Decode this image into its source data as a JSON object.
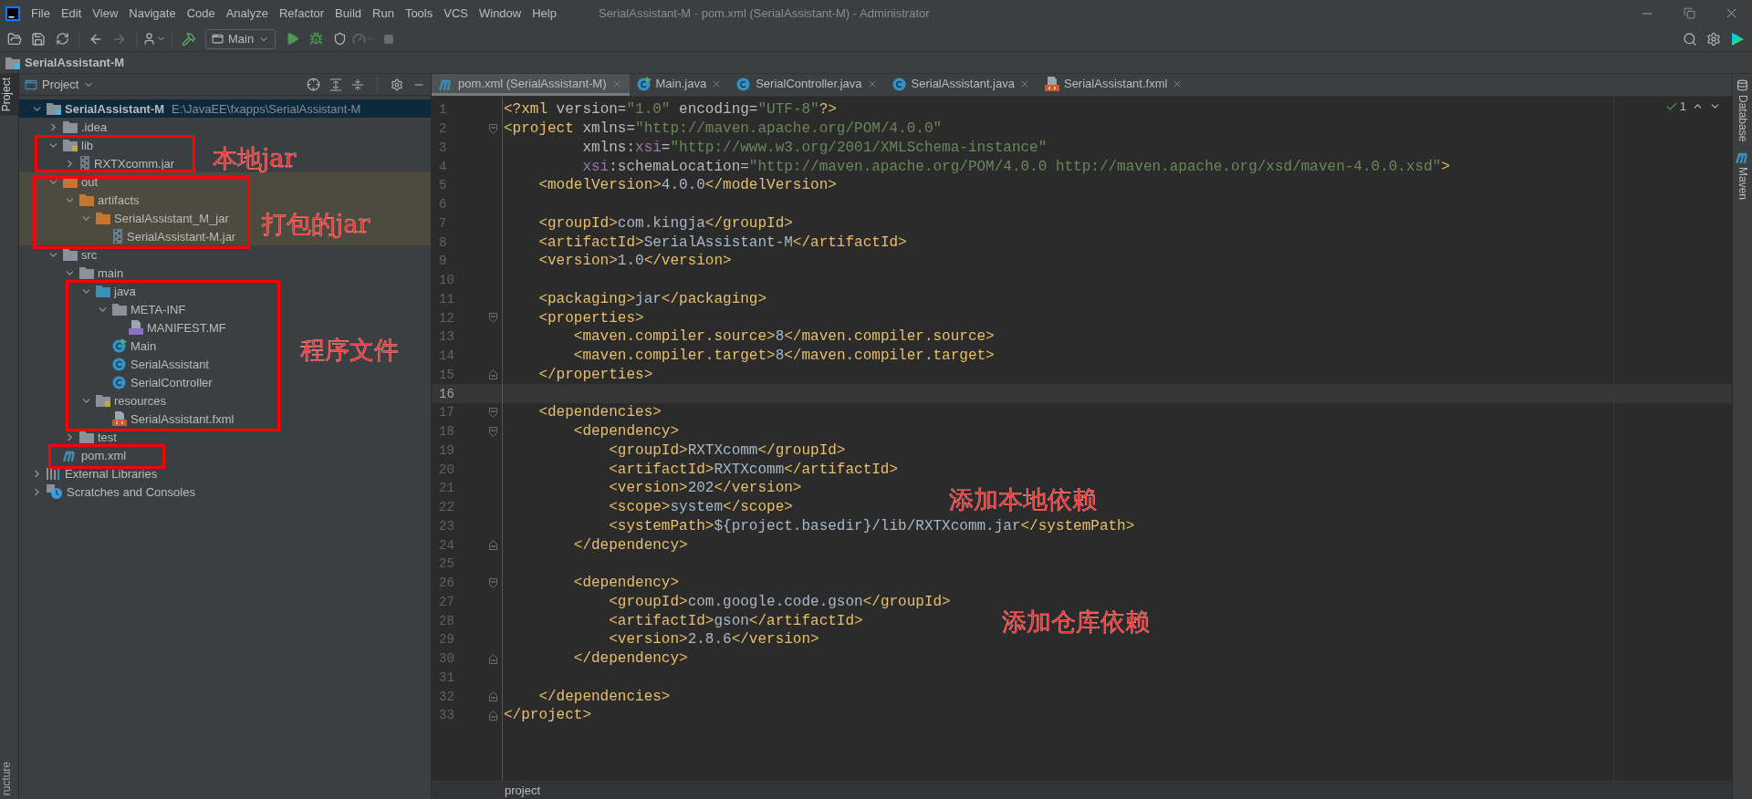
{
  "title_bar": {
    "menus": [
      "File",
      "Edit",
      "View",
      "Navigate",
      "Code",
      "Analyze",
      "Refactor",
      "Build",
      "Run",
      "Tools",
      "VCS",
      "Window",
      "Help"
    ],
    "title": "SerialAssistant-M - pom.xml (SerialAssistant-M) - Administrator"
  },
  "toolbar": {
    "run_config": "Main"
  },
  "nav_bar": {
    "breadcrumb": "SerialAssistant-M"
  },
  "left_strip": [
    {
      "label": "Project",
      "selected": true
    },
    {
      "label": "ructure",
      "selected": false
    }
  ],
  "project_panel": {
    "title": "Project",
    "tree": [
      {
        "label": "SerialAssistant-M",
        "path": "E:\\JavaEE\\fxapps\\SerialAssistant-M",
        "kind": "module",
        "expanded": true,
        "selected": true,
        "excluded": false,
        "children": [
          {
            "label": ".idea",
            "kind": "folder",
            "expanded": false,
            "selected": false,
            "excluded": false
          },
          {
            "label": "lib",
            "kind": "folder-lib",
            "expanded": true,
            "selected": false,
            "excluded": false,
            "children": [
              {
                "label": "RXTXcomm.jar",
                "kind": "jar",
                "expanded": false,
                "selected": false,
                "excluded": false
              }
            ]
          },
          {
            "label": "out",
            "kind": "folder-excluded",
            "expanded": true,
            "selected": false,
            "excluded": true,
            "children": [
              {
                "label": "artifacts",
                "kind": "folder-excluded",
                "expanded": true,
                "selected": false,
                "excluded": true,
                "children": [
                  {
                    "label": "SerialAssistant_M_jar",
                    "kind": "folder-excluded",
                    "expanded": true,
                    "selected": false,
                    "excluded": true,
                    "children": [
                      {
                        "label": "SerialAssistant-M.jar",
                        "kind": "jar",
                        "selected": false,
                        "excluded": true
                      }
                    ]
                  }
                ]
              }
            ]
          },
          {
            "label": "src",
            "kind": "folder",
            "expanded": true,
            "selected": false,
            "excluded": false,
            "children": [
              {
                "label": "main",
                "kind": "folder",
                "expanded": true,
                "selected": false,
                "excluded": false,
                "children": [
                  {
                    "label": "java",
                    "kind": "folder-source",
                    "expanded": true,
                    "selected": false,
                    "excluded": false,
                    "children": [
                      {
                        "label": "META-INF",
                        "kind": "folder",
                        "expanded": true,
                        "selected": false,
                        "excluded": false,
                        "children": [
                          {
                            "label": "MANIFEST.MF",
                            "kind": "manifest",
                            "selected": false,
                            "excluded": false
                          }
                        ]
                      },
                      {
                        "label": "Main",
                        "kind": "class-main",
                        "selected": false,
                        "excluded": false
                      },
                      {
                        "label": "SerialAssistant",
                        "kind": "class",
                        "selected": false,
                        "excluded": false
                      },
                      {
                        "label": "SerialController",
                        "kind": "class",
                        "selected": false,
                        "excluded": false
                      }
                    ]
                  },
                  {
                    "label": "resources",
                    "kind": "folder-resources",
                    "expanded": true,
                    "selected": false,
                    "excluded": false,
                    "children": [
                      {
                        "label": "SerialAssistant.fxml",
                        "kind": "fxml",
                        "selected": false,
                        "excluded": false
                      }
                    ]
                  }
                ]
              },
              {
                "label": "test",
                "kind": "folder",
                "expanded": false,
                "selected": false,
                "excluded": false
              }
            ]
          },
          {
            "label": "pom.xml",
            "kind": "maven",
            "selected": false,
            "excluded": false
          }
        ]
      },
      {
        "label": "External Libraries",
        "kind": "libraries",
        "expanded": false,
        "selected": false,
        "excluded": false
      },
      {
        "label": "Scratches and Consoles",
        "kind": "scratches",
        "expanded": false,
        "selected": false,
        "excluded": false
      }
    ]
  },
  "tabs": [
    {
      "label": "pom.xml (SerialAssistant-M)",
      "kind": "maven",
      "selected": true
    },
    {
      "label": "Main.java",
      "kind": "class-main",
      "selected": false
    },
    {
      "label": "SerialController.java",
      "kind": "class",
      "selected": false
    },
    {
      "label": "SerialAssistant.java",
      "kind": "class",
      "selected": false
    },
    {
      "label": "SerialAssistant.fxml",
      "kind": "fxml",
      "selected": false
    }
  ],
  "editor": {
    "inspection_count": "1",
    "breadcrumb": "project",
    "lines": [
      {
        "number": "1",
        "current": false,
        "kind": "plain",
        "tokens": [
          {
            "kind": "tag",
            "text": "<?xml"
          },
          {
            "kind": "attr",
            "text": " version="
          },
          {
            "kind": "value",
            "text": "\"1.0\""
          },
          {
            "kind": "attr",
            "text": " encoding="
          },
          {
            "kind": "value",
            "text": "\"UTF-8\""
          },
          {
            "kind": "tag",
            "text": "?>"
          }
        ]
      },
      {
        "number": "2",
        "current": false,
        "kind": "fold-start",
        "tokens": [
          {
            "kind": "tag",
            "text": "<project"
          },
          {
            "kind": "attr",
            "text": " xmlns="
          },
          {
            "kind": "value",
            "text": "\"http://maven.apache.org/POM/4.0.0\""
          }
        ]
      },
      {
        "number": "3",
        "current": false,
        "kind": "plain",
        "tokens": [
          {
            "kind": "attr",
            "text": "         xmlns:"
          },
          {
            "kind": "ns",
            "text": "xsi"
          },
          {
            "kind": "attr",
            "text": "="
          },
          {
            "kind": "value",
            "text": "\"http://www.w3.org/2001/XMLSchema-instance\""
          }
        ]
      },
      {
        "number": "4",
        "current": false,
        "kind": "plain",
        "tokens": [
          {
            "kind": "ns",
            "text": "         xsi"
          },
          {
            "kind": "attr",
            "text": ":schemaLocation="
          },
          {
            "kind": "value",
            "text": "\"http://maven.apache.org/POM/4.0.0 http://maven.apache.org/xsd/maven-4.0.0.xsd\""
          },
          {
            "kind": "tag",
            "text": ">"
          }
        ]
      },
      {
        "number": "5",
        "current": false,
        "kind": "plain",
        "tokens": [
          {
            "kind": "tag",
            "text": "    <modelVersion>"
          },
          {
            "kind": "text",
            "text": "4.0.0"
          },
          {
            "kind": "tag",
            "text": "</modelVersion>"
          }
        ]
      },
      {
        "number": "6",
        "current": false,
        "kind": "plain"
      },
      {
        "number": "7",
        "current": false,
        "kind": "plain",
        "tokens": [
          {
            "kind": "tag",
            "text": "    <groupId>"
          },
          {
            "kind": "text",
            "text": "com.kingja"
          },
          {
            "kind": "tag",
            "text": "</groupId>"
          }
        ]
      },
      {
        "number": "8",
        "current": false,
        "kind": "plain",
        "tokens": [
          {
            "kind": "tag",
            "text": "    <artifactId>"
          },
          {
            "kind": "text",
            "text": "SerialAssistant-M"
          },
          {
            "kind": "tag",
            "text": "</artifactId>"
          }
        ]
      },
      {
        "number": "9",
        "current": false,
        "kind": "plain",
        "tokens": [
          {
            "kind": "tag",
            "text": "    <version>"
          },
          {
            "kind": "text",
            "text": "1.0"
          },
          {
            "kind": "tag",
            "text": "</version>"
          }
        ]
      },
      {
        "number": "10",
        "current": false,
        "kind": "plain"
      },
      {
        "number": "11",
        "current": false,
        "kind": "plain",
        "tokens": [
          {
            "kind": "tag",
            "text": "    <packaging>"
          },
          {
            "kind": "text",
            "text": "jar"
          },
          {
            "kind": "tag",
            "text": "</packaging>"
          }
        ]
      },
      {
        "number": "12",
        "current": false,
        "kind": "fold-start",
        "tokens": [
          {
            "kind": "tag",
            "text": "    <properties>"
          }
        ]
      },
      {
        "number": "13",
        "current": false,
        "kind": "plain",
        "tokens": [
          {
            "kind": "tag",
            "text": "        <maven.compiler.source>"
          },
          {
            "kind": "text",
            "text": "8"
          },
          {
            "kind": "tag",
            "text": "</maven.compiler.source>"
          }
        ]
      },
      {
        "number": "14",
        "current": false,
        "kind": "plain",
        "tokens": [
          {
            "kind": "tag",
            "text": "        <maven.compiler.target>"
          },
          {
            "kind": "text",
            "text": "8"
          },
          {
            "kind": "tag",
            "text": "</maven.compiler.target>"
          }
        ]
      },
      {
        "number": "15",
        "current": false,
        "kind": "fold-end",
        "tokens": [
          {
            "kind": "tag",
            "text": "    </properties>"
          }
        ]
      },
      {
        "number": "16",
        "current": true,
        "kind": "plain"
      },
      {
        "number": "17",
        "current": false,
        "kind": "fold-start",
        "tokens": [
          {
            "kind": "tag",
            "text": "    <dependencies>"
          }
        ]
      },
      {
        "number": "18",
        "current": false,
        "kind": "fold-start",
        "tokens": [
          {
            "kind": "tag",
            "text": "        <dependency>"
          }
        ]
      },
      {
        "number": "19",
        "current": false,
        "kind": "plain",
        "tokens": [
          {
            "kind": "tag",
            "text": "            <groupId>"
          },
          {
            "kind": "text",
            "text": "RXTXcomm"
          },
          {
            "kind": "tag",
            "text": "</groupId>"
          }
        ]
      },
      {
        "number": "20",
        "current": false,
        "kind": "plain",
        "tokens": [
          {
            "kind": "tag",
            "text": "            <artifactId>"
          },
          {
            "kind": "text",
            "text": "RXTXcomm"
          },
          {
            "kind": "tag",
            "text": "</artifactId>"
          }
        ]
      },
      {
        "number": "21",
        "current": false,
        "kind": "plain",
        "tokens": [
          {
            "kind": "tag",
            "text": "            <version>"
          },
          {
            "kind": "text",
            "text": "202"
          },
          {
            "kind": "tag",
            "text": "</version>"
          }
        ]
      },
      {
        "number": "22",
        "current": false,
        "kind": "plain",
        "tokens": [
          {
            "kind": "tag",
            "text": "            <scope>"
          },
          {
            "kind": "text",
            "text": "system"
          },
          {
            "kind": "tag",
            "text": "</scope>"
          }
        ]
      },
      {
        "number": "23",
        "current": false,
        "kind": "plain",
        "tokens": [
          {
            "kind": "tag",
            "text": "            <systemPath>"
          },
          {
            "kind": "text",
            "text": "${project.basedir}/lib/RXTXcomm.jar"
          },
          {
            "kind": "tag",
            "text": "</systemPath>"
          }
        ]
      },
      {
        "number": "24",
        "current": false,
        "kind": "fold-end",
        "tokens": [
          {
            "kind": "tag",
            "text": "        </dependency>"
          }
        ]
      },
      {
        "number": "25",
        "current": false,
        "kind": "plain"
      },
      {
        "number": "26",
        "current": false,
        "kind": "fold-start",
        "tokens": [
          {
            "kind": "tag",
            "text": "        <dependency>"
          }
        ]
      },
      {
        "number": "27",
        "current": false,
        "kind": "plain",
        "tokens": [
          {
            "kind": "tag",
            "text": "            <groupId>"
          },
          {
            "kind": "text",
            "text": "com.google.code.gson"
          },
          {
            "kind": "tag",
            "text": "</groupId>"
          }
        ]
      },
      {
        "number": "28",
        "current": false,
        "kind": "plain",
        "tokens": [
          {
            "kind": "tag",
            "text": "            <artifactId>"
          },
          {
            "kind": "text",
            "text": "gson"
          },
          {
            "kind": "tag",
            "text": "</artifactId>"
          }
        ]
      },
      {
        "number": "29",
        "current": false,
        "kind": "plain",
        "tokens": [
          {
            "kind": "tag",
            "text": "            <version>"
          },
          {
            "kind": "text",
            "text": "2.8.6"
          },
          {
            "kind": "tag",
            "text": "</version>"
          }
        ]
      },
      {
        "number": "30",
        "current": false,
        "kind": "fold-end",
        "tokens": [
          {
            "kind": "tag",
            "text": "        </dependency>"
          }
        ]
      },
      {
        "number": "31",
        "current": false,
        "kind": "plain"
      },
      {
        "number": "32",
        "current": false,
        "kind": "fold-end",
        "tokens": [
          {
            "kind": "tag",
            "text": "    </dependencies>"
          }
        ]
      },
      {
        "number": "33",
        "current": false,
        "kind": "fold-end",
        "tokens": [
          {
            "kind": "tag",
            "text": "</project>"
          }
        ]
      }
    ]
  },
  "right_strip": [
    {
      "label": "Database",
      "kind": "database"
    },
    {
      "label": "Maven",
      "kind": "maven"
    }
  ],
  "annotations": [
    {
      "text": "本地jar"
    },
    {
      "text": "打包的jar"
    },
    {
      "text": "程序文件"
    },
    {
      "text": "添加本地依赖"
    },
    {
      "text": "添加仓库依赖"
    }
  ]
}
